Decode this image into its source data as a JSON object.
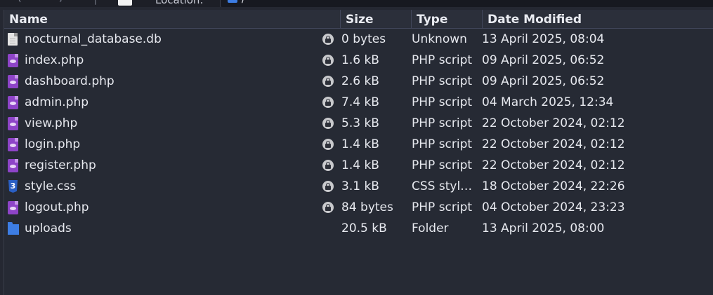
{
  "toolbar": {
    "location_label": "Location:",
    "location_path": "/"
  },
  "columns": {
    "name": "Name",
    "size": "Size",
    "type": "Type",
    "date": "Date Modified"
  },
  "files": [
    {
      "name": "nocturnal_database.db",
      "icon": "generic-file-icon",
      "locked": true,
      "size": "0 bytes",
      "type": "Unknown",
      "date": "13 April 2025, 08:04"
    },
    {
      "name": "index.php",
      "icon": "php-file-icon",
      "locked": true,
      "size": "1.6 kB",
      "type": "PHP script",
      "date": "09 April 2025, 06:52"
    },
    {
      "name": "dashboard.php",
      "icon": "php-file-icon",
      "locked": true,
      "size": "2.6 kB",
      "type": "PHP script",
      "date": "09 April 2025, 06:52"
    },
    {
      "name": "admin.php",
      "icon": "php-file-icon",
      "locked": true,
      "size": "7.4 kB",
      "type": "PHP script",
      "date": "04 March 2025, 12:34"
    },
    {
      "name": "view.php",
      "icon": "php-file-icon",
      "locked": true,
      "size": "5.3 kB",
      "type": "PHP script",
      "date": "22 October 2024, 02:12"
    },
    {
      "name": "login.php",
      "icon": "php-file-icon",
      "locked": true,
      "size": "1.4 kB",
      "type": "PHP script",
      "date": "22 October 2024, 02:12"
    },
    {
      "name": "register.php",
      "icon": "php-file-icon",
      "locked": true,
      "size": "1.4 kB",
      "type": "PHP script",
      "date": "22 October 2024, 02:12"
    },
    {
      "name": "style.css",
      "icon": "css-file-icon",
      "locked": true,
      "size": "3.1 kB",
      "type": "CSS styl…",
      "date": "18 October 2024, 22:26"
    },
    {
      "name": "logout.php",
      "icon": "php-file-icon",
      "locked": true,
      "size": "84 bytes",
      "type": "PHP script",
      "date": "04 October 2024, 23:23"
    },
    {
      "name": "uploads",
      "icon": "folder-icon",
      "locked": false,
      "size": "20.5 kB",
      "type": "Folder",
      "date": "13 April 2025, 08:00"
    }
  ]
}
